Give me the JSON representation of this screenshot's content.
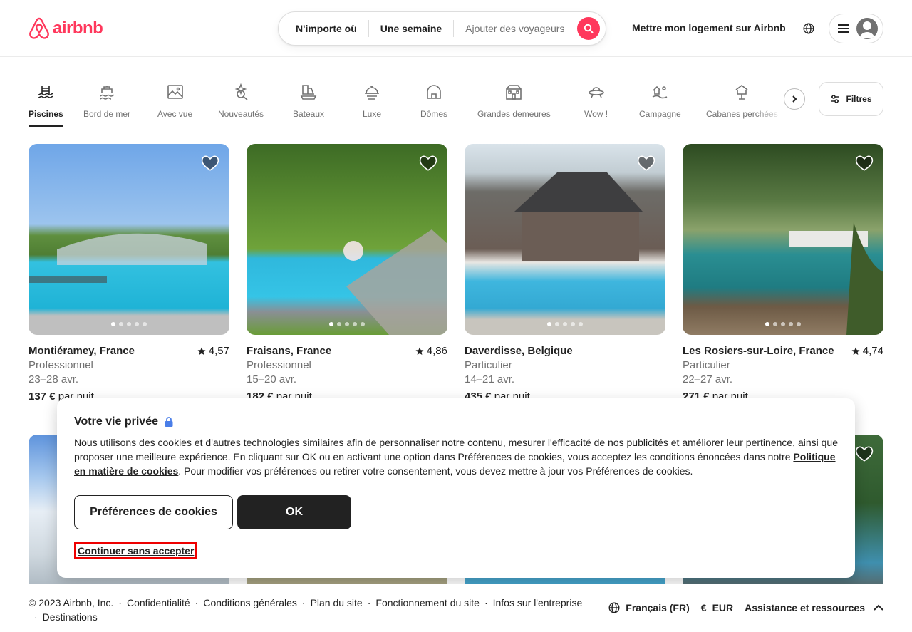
{
  "brand": {
    "name": "airbnb",
    "color": "#ff385c"
  },
  "search": {
    "where": "N'importe où",
    "when": "Une semaine",
    "guests": "Ajouter des voyageurs"
  },
  "header": {
    "host_link": "Mettre mon logement sur Airbnb"
  },
  "categories": [
    {
      "label": "Piscines",
      "icon": "pool-icon"
    },
    {
      "label": "Bord de mer",
      "icon": "beach-icon"
    },
    {
      "label": "Avec vue",
      "icon": "view-icon"
    },
    {
      "label": "Nouveautés",
      "icon": "new-icon"
    },
    {
      "label": "Bateaux",
      "icon": "boat-icon"
    },
    {
      "label": "Luxe",
      "icon": "luxe-icon"
    },
    {
      "label": "Dômes",
      "icon": "dome-icon"
    },
    {
      "label": "Grandes demeures",
      "icon": "mansion-icon"
    },
    {
      "label": "Wow !",
      "icon": "ufo-icon"
    },
    {
      "label": "Campagne",
      "icon": "countryside-icon"
    },
    {
      "label": "Cabanes perchées",
      "icon": "treehouse-icon"
    }
  ],
  "active_category": "Piscines",
  "filters_label": "Filtres",
  "listings": [
    {
      "location": "Montiéramey, France",
      "rating": "4,57",
      "host_type": "Professionnel",
      "dates": "23–28 avr.",
      "price": "137 €",
      "price_suffix": "par nuit"
    },
    {
      "location": "Fraisans, France",
      "rating": "4,86",
      "host_type": "Professionnel",
      "dates": "15–20 avr.",
      "price": "182 €",
      "price_suffix": "par nuit"
    },
    {
      "location": "Daverdisse, Belgique",
      "rating": "",
      "host_type": "Particulier",
      "dates": "14–21 avr.",
      "price": "435 €",
      "price_suffix": "par nuit"
    },
    {
      "location": "Les Rosiers-sur-Loire, France",
      "rating": "4,74",
      "host_type": "Particulier",
      "dates": "22–27 avr.",
      "price": "271 €",
      "price_suffix": "par nuit"
    }
  ],
  "privacy": {
    "title": "Votre vie privée",
    "body_pre": "Nous utilisons des cookies et d'autres technologies similaires afin de personnaliser notre contenu, mesurer l'efficacité de nos publicités et améliorer leur pertinence, ainsi que proposer une meilleure expérience. En cliquant sur OK ou en activant une option dans Préférences de cookies, vous acceptez les conditions énoncées dans notre ",
    "policy_link": "Politique en matière de cookies",
    "body_post": ". Pour modifier vos préférences ou retirer votre consentement, vous devez mettre à jour vos Préférences de cookies.",
    "prefs_button": "Préférences de cookies",
    "ok_button": "OK",
    "continue_link": "Continuer sans accepter"
  },
  "footer": {
    "copyright": "© 2023 Airbnb, Inc.",
    "links": [
      "Confidentialité",
      "Conditions générales",
      "Plan du site",
      "Fonctionnement du site",
      "Infos sur l'entreprise",
      "Destinations"
    ],
    "language": "Français (FR)",
    "currency_symbol": "€",
    "currency": "EUR",
    "support": "Assistance et ressources"
  }
}
